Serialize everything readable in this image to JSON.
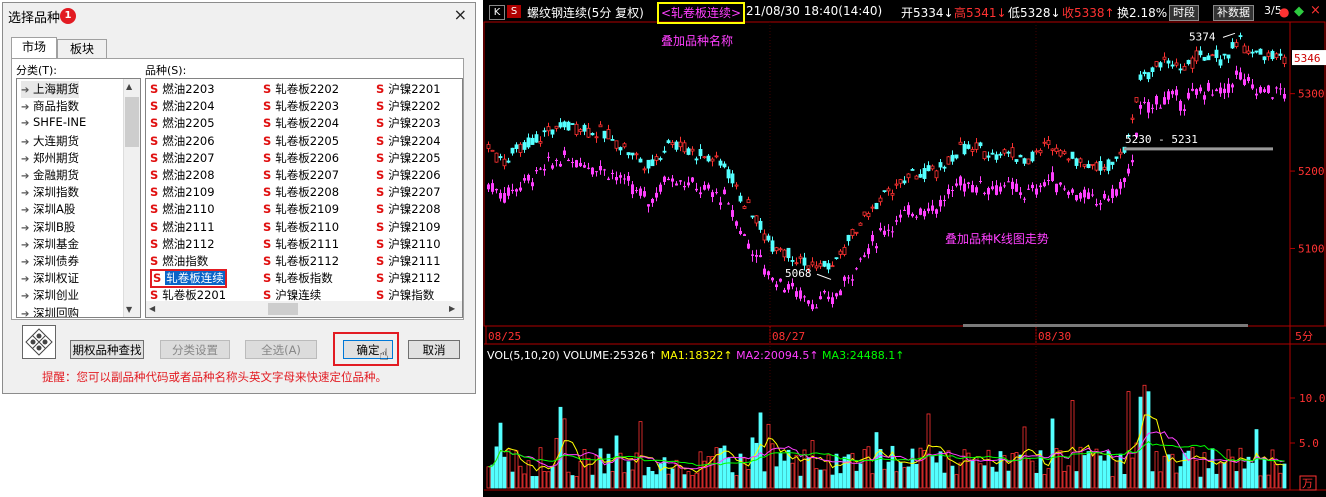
{
  "dialog": {
    "title": "选择品种",
    "badge": "1",
    "close": "×",
    "tabs": [
      "市场",
      "板块"
    ],
    "category_label": "分类(T):",
    "symbol_label": "品种(S):",
    "categories": [
      "上海期货",
      "商品指数",
      "SHFE-INE",
      "大连期货",
      "郑州期货",
      "金融期货",
      "深圳指数",
      "深圳A股",
      "深圳B股",
      "深圳基金",
      "深圳债券",
      "深圳权证",
      "深圳创业",
      "深圳回购"
    ],
    "symbols_col1": [
      "燃油2203",
      "燃油2204",
      "燃油2205",
      "燃油2206",
      "燃油2207",
      "燃油2208",
      "燃油2109",
      "燃油2110",
      "燃油2111",
      "燃油2112",
      "燃油指数",
      "轧卷板连续",
      "轧卷板2201"
    ],
    "symbols_col2": [
      "轧卷板2202",
      "轧卷板2203",
      "轧卷板2204",
      "轧卷板2205",
      "轧卷板2206",
      "轧卷板2207",
      "轧卷板2208",
      "轧卷板2109",
      "轧卷板2110",
      "轧卷板2111",
      "轧卷板2112",
      "轧卷板指数",
      "沪镍连续"
    ],
    "symbols_col3": [
      "沪镍2201",
      "沪镍2202",
      "沪镍2203",
      "沪镍2204",
      "沪镍2205",
      "沪镍2206",
      "沪镍2207",
      "沪镍2208",
      "沪镍2109",
      "沪镍2110",
      "沪镍2111",
      "沪镍2112",
      "沪镍指数"
    ],
    "symbol_prefix": "S",
    "selected_symbol": "轧卷板连续",
    "buttons": {
      "lookup": "期权品种查找",
      "class_setting": "分类设置",
      "select_all": "全选(A)",
      "ok": "确定",
      "cancel": "取消"
    },
    "tip": "提醒：您可以副品种代码或者品种名称头英文字母来快速定位品种。"
  },
  "chart": {
    "header": {
      "k_label": "K",
      "s_label": "S",
      "symbol": "螺纹钢连续(5分 复权)",
      "overlay": "<轧卷板连续>",
      "datetime": "21/08/30 18:40(14:40)",
      "open": "开5334↓",
      "high": "高5341↓",
      "low": "低5328↓",
      "close": "收5338↑",
      "turnover": "换2.18%",
      "btn_period": "时段",
      "btn_supplement": "补数据",
      "count": "3/5"
    },
    "overlay_name_annotation": "叠加品种名称",
    "overlay_trend_annotation": "叠加品种K线图走势",
    "price_axis": [
      "5346",
      "5300",
      "5200",
      "5100"
    ],
    "annotations": {
      "high": "5374",
      "low": "5068",
      "range": "5230 - 5231"
    },
    "date_axis": [
      "08/25",
      "08/27",
      "08/30"
    ],
    "period_label": "5分",
    "volume_header": {
      "name": "VOL(5,10,20)",
      "volume": "VOLUME:25326↑",
      "ma1": "MA1:18322↑",
      "ma2": "MA2:20094.5↑",
      "ma3": "MA3:24488.1↑"
    },
    "volume_axis": [
      "10.0",
      "5.0"
    ],
    "volume_unit": "万",
    "colors": {
      "up": "#ff3232",
      "down": "#54ffff",
      "overlay": "#ff40ff",
      "axis": "#b00000",
      "ma1": "#ffffff",
      "ma2": "#ffff00",
      "ma3": "#ff40ff",
      "ma4": "#00ff00"
    }
  }
}
